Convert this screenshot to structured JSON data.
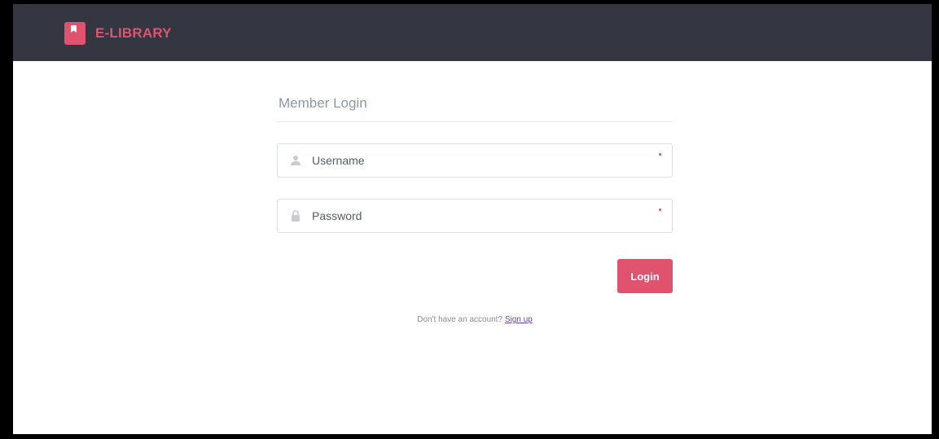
{
  "navbar": {
    "brand_text": "E-LIBRARY",
    "brand_icon": "bookmark-book-icon",
    "background_color": "#343641",
    "accent_color": "#e0536f"
  },
  "login": {
    "title": "Member Login",
    "username": {
      "placeholder": "Username",
      "value": "",
      "icon": "user-icon",
      "required": true
    },
    "password": {
      "placeholder": "Password",
      "value": "",
      "icon": "lock-icon",
      "required": true
    },
    "submit_label": "Login",
    "signup_prompt": "Don't have an account?",
    "signup_link": "Sign up"
  }
}
